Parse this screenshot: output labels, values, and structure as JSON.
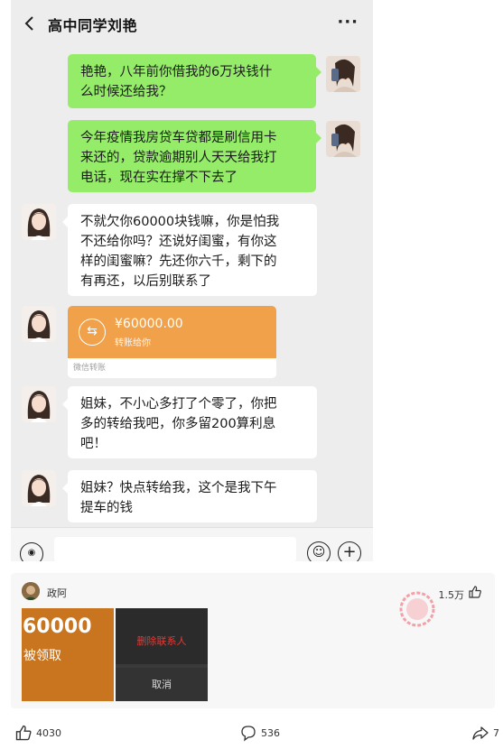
{
  "chat": {
    "title": "高中同学刘艳",
    "more": "···",
    "messages": [
      {
        "side": "me",
        "lines": [
          "艳艳，八年前你借我的6万块钱什",
          "么时候还给我？"
        ]
      },
      {
        "side": "me",
        "lines": [
          "今年疫情我房贷车贷都是刷信用卡",
          "来还的，贷款逾期别人天天给我打",
          "电话，现在实在撑不下去了"
        ]
      },
      {
        "side": "them",
        "lines": [
          "不就欠你60000块钱嘛，你是怕我",
          "不还给你吗？还说好闺蜜，有你这",
          "样的闺蜜嘛？先还你六千，剩下的",
          "有再还，以后别联系了"
        ]
      },
      {
        "side": "them",
        "lines": [
          "姐妹，不小心多打了个零了，你把",
          "多的转给我吧，你多留200算利息",
          "吧！"
        ]
      },
      {
        "side": "them",
        "lines": [
          "姐妹？快点转给我，这个是我下午",
          "提车的钱"
        ]
      }
    ],
    "transfer": {
      "amount": "¥60000.00",
      "subtitle": "转账给你",
      "footer": "微信转账"
    }
  },
  "comment": {
    "username": "政阿",
    "like_count": "1.5万",
    "image1": {
      "big": "60000",
      "small": "被领取"
    },
    "image2": {
      "delete_label": "删除联系人",
      "cancel_label": "取消"
    }
  },
  "actions": {
    "likes": "4030",
    "comments": "536",
    "shares": "7"
  },
  "colors": {
    "chat_bg": "#ededed",
    "my_bubble": "#95ec69",
    "their_bubble": "#ffffff",
    "transfer_orange": "#f0a14a"
  }
}
